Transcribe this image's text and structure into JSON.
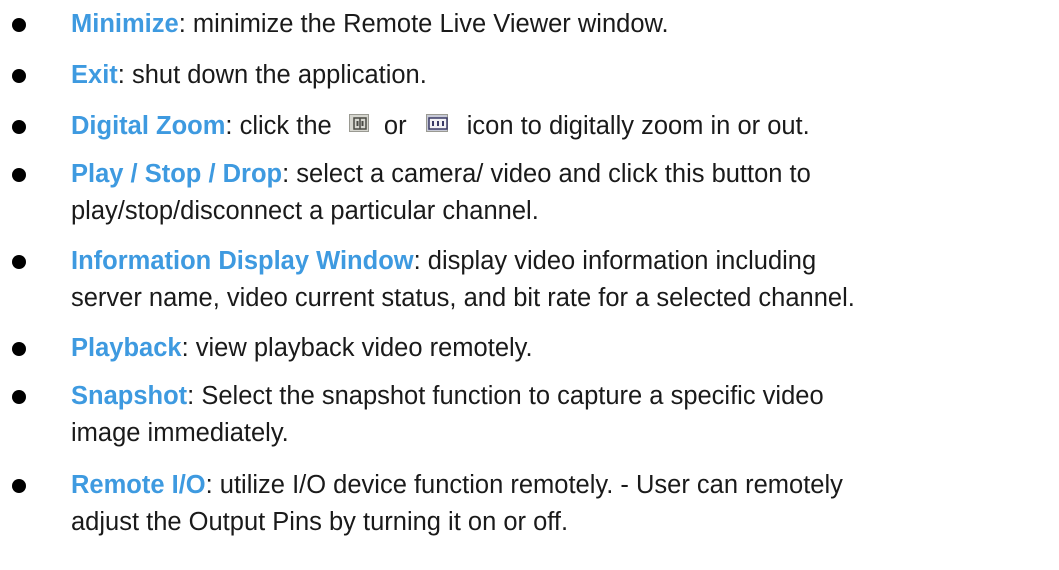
{
  "items": [
    {
      "term": "Minimize",
      "text": ": minimize the Remote Live Viewer window."
    },
    {
      "term": "Exit",
      "text": ": shut down the application."
    },
    {
      "term": "Digital Zoom",
      "text_before": ": click the",
      "text_middle": "or",
      "text_after": "icon to digitally zoom in or out.",
      "icons": [
        "zoom-in-icon",
        "zoom-out-icon"
      ]
    },
    {
      "term": "Play / Stop / Drop",
      "line1": ": select a camera/ video and click this button to",
      "line2": "play/stop/disconnect a particular channel."
    },
    {
      "term": "Information Display Window",
      "line1": ": display video information including",
      "line2": "server name, video current status, and bit rate for a selected channel."
    },
    {
      "term": "Playback",
      "text": ": view playback video remotely."
    },
    {
      "term": "Snapshot",
      "line1": ": Select the snapshot function to capture a specific video",
      "line2": "image immediately."
    },
    {
      "term": "Remote I/O",
      "line1": ": utilize I/O device function remotely. - User can remotely",
      "line2": "adjust the Output Pins by turning it on or off."
    }
  ],
  "colors": {
    "term": "#3e9ae0",
    "text": "#1a1a1a",
    "bullet": "#000000"
  }
}
